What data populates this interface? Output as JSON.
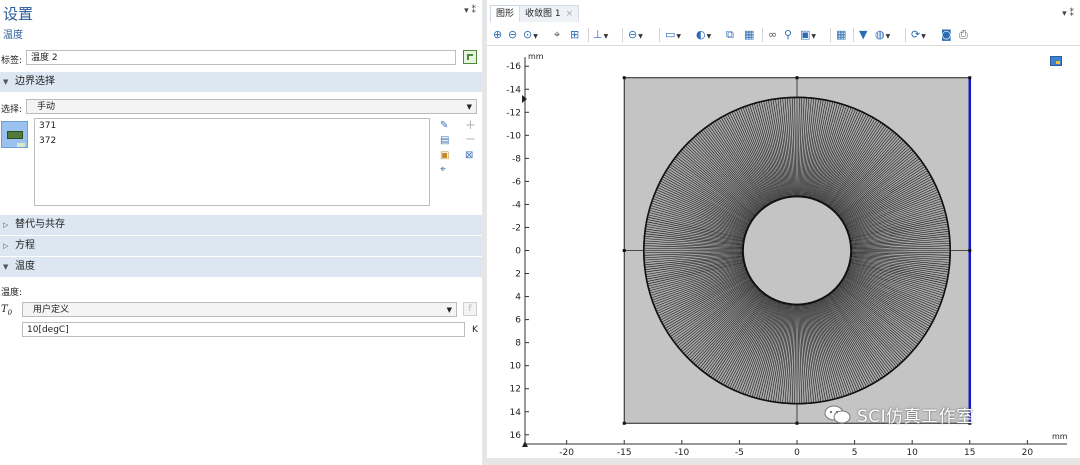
{
  "settings": {
    "title": "设置",
    "subtitle": "温度",
    "controls": "▾ ⁑",
    "label_caption": "标签:",
    "label_value": "温度 2",
    "sections": {
      "boundary_selection": "边界选择",
      "override_coexist": "替代与共存",
      "equation": "方程",
      "temperature": "温度"
    },
    "selection_caption": "选择:",
    "selection_value": "手动",
    "selection_items": [
      "371",
      "372"
    ],
    "temperature_caption": "温度:",
    "t0_symbol": "T",
    "t0_subscript": "0",
    "t0_mode": "用户定义",
    "t0_value": "10[degC]",
    "t0_unit": "K"
  },
  "graphics": {
    "tabs": [
      {
        "label": "图形"
      },
      {
        "label": "收敛图 1",
        "close": "×"
      }
    ],
    "panel_controls": "▾ ⁑",
    "unit_y": "mm",
    "unit_x": "mm",
    "x_ticks": [
      "-20",
      "-15",
      "-10",
      "-5",
      "0",
      "5",
      "10",
      "15",
      "20"
    ],
    "y_ticks": [
      "16",
      "14",
      "12",
      "10",
      "8",
      "6",
      "4",
      "2",
      "0",
      "-2",
      "-4",
      "-6",
      "-8",
      "-10",
      "-12",
      "-14",
      "-16"
    ],
    "watermark": "SCI仿真工作室",
    "colors": {
      "geometry_fill": "#c4c4c4",
      "mesh_line": "#111111",
      "selected_boundary": "#1515cc",
      "section_header": "#dde7f2",
      "accent": "#2a5a99"
    }
  },
  "chart_data": {
    "type": "scatter",
    "xlabel": "mm",
    "ylabel": "mm",
    "xlim": [
      -23,
      22
    ],
    "ylim": [
      -16.8,
      16.8
    ],
    "x_ticks": [
      -20,
      -15,
      -10,
      -5,
      0,
      5,
      10,
      15,
      20
    ],
    "y_ticks": [
      -16,
      -14,
      -12,
      -10,
      -8,
      -6,
      -4,
      -2,
      0,
      2,
      4,
      6,
      8,
      10,
      12,
      14,
      16
    ],
    "square": {
      "xmin": -15,
      "xmax": 15,
      "ymin": -15,
      "ymax": 15
    },
    "annulus": {
      "cx": 0,
      "cy": 0,
      "r_inner": 4.7,
      "r_outer": 13.3
    },
    "selected_edge": {
      "x": 15,
      "ymin": -15,
      "ymax": 15
    },
    "vertices": [
      [
        -15,
        15
      ],
      [
        0,
        15
      ],
      [
        15,
        15
      ],
      [
        -15,
        0
      ],
      [
        15,
        0
      ],
      [
        -15,
        -15
      ],
      [
        0,
        -15
      ],
      [
        15,
        -15
      ]
    ],
    "mesh_spokes": 400,
    "grid": false
  }
}
